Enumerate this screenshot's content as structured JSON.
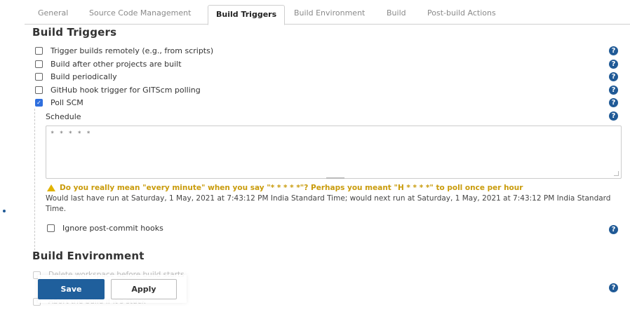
{
  "tabs": [
    {
      "label": "General"
    },
    {
      "label": "Source Code Management"
    },
    {
      "label": "Build Triggers"
    },
    {
      "label": "Build Environment"
    },
    {
      "label": "Build"
    },
    {
      "label": "Post-build Actions"
    }
  ],
  "build_triggers": {
    "title": "Build Triggers",
    "options": [
      {
        "label": "Trigger builds remotely (e.g., from scripts)",
        "checked": false
      },
      {
        "label": "Build after other projects are built",
        "checked": false
      },
      {
        "label": "Build periodically",
        "checked": false
      },
      {
        "label": "GitHub hook trigger for GITScm polling",
        "checked": false
      },
      {
        "label": "Poll SCM",
        "checked": true
      }
    ],
    "schedule": {
      "label": "Schedule",
      "value": "* * * * *"
    },
    "warning": "Do you really mean \"every minute\" when you say \"* * * * *\"? Perhaps you meant \"H * * * *\" to poll once per hour",
    "note": "Would last have run at Saturday, 1 May, 2021 at 7:43:12 PM India Standard Time; would next run at Saturday, 1 May, 2021 at 7:43:12 PM India Standard Time.",
    "ignore_hooks": {
      "label": "Ignore post-commit hooks",
      "checked": false
    }
  },
  "build_environment": {
    "title": "Build Environment",
    "options": [
      {
        "label": "Delete workspace before build starts"
      },
      {
        "label": "Abort the build if it's stuck"
      }
    ]
  },
  "help_icon": "?",
  "actions": {
    "save": "Save",
    "apply": "Apply"
  }
}
